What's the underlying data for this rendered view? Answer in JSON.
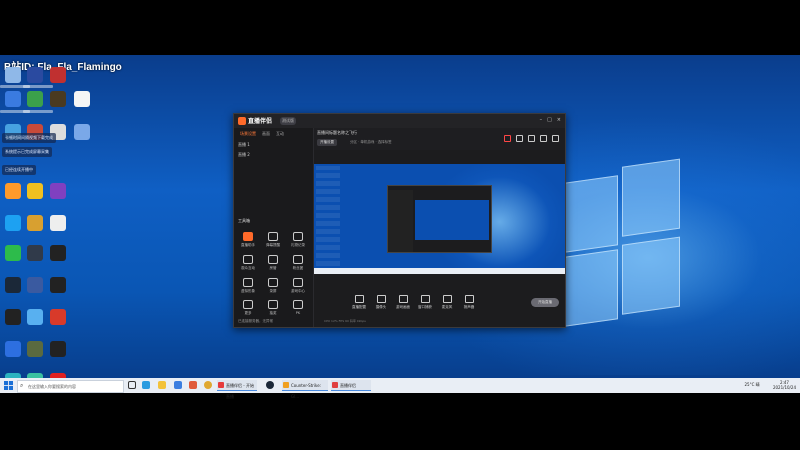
{
  "watermark": "B站ID: Fla_Fla_Flamingo",
  "desktop": {
    "notifications": [
      "卡顿时间间隔视频下载完成",
      "系统提示已完成屏幕采集",
      "已经连续开播中"
    ]
  },
  "app": {
    "title": "直播伴侣",
    "badge": "测试版",
    "window_buttons": [
      "–",
      "□",
      "×"
    ],
    "tabs": [
      "场景设置",
      "画面",
      "互动"
    ],
    "scenes": [
      "直播 1",
      "直播 2"
    ],
    "room_title": "直播间标题名称之飞行",
    "room_button": "开播设置",
    "room_info": "分区 · 单机游戏 · 选择标签",
    "tools_title": "工具箱",
    "tools": [
      "直播助手",
      "弹幕提醒",
      "礼物记录",
      "观众互动",
      "房管",
      "粉丝团",
      "虚拟形象",
      "录屏",
      "游戏中心",
      "更多",
      "抽奖",
      "PK"
    ],
    "controls": [
      "直播配置",
      "摄像头",
      "游戏画面",
      "窗口捕获",
      "麦克风",
      "扬声器"
    ],
    "live_button": "开始直播",
    "bottom_note": "已连接服务器，无异常",
    "footer": "CPU 12%   FPS 60   码率 0kbps"
  },
  "taskbar": {
    "search_placeholder": "在这里输入你要搜索的内容",
    "apps": [
      {
        "label": "直播伴侣 - 开始直播",
        "color": "#e63b3b"
      },
      {
        "label": "Counter-Strike: Gl...",
        "color": "#f0a020"
      },
      {
        "label": "直播伴侣",
        "color": "#e04040"
      }
    ],
    "tray_temp": "25°C 晴",
    "time": "2:47",
    "date": "2021/10/24"
  },
  "colors": {
    "accent": "#ff6a2a",
    "desktop_blue": "#0f5fc4"
  }
}
